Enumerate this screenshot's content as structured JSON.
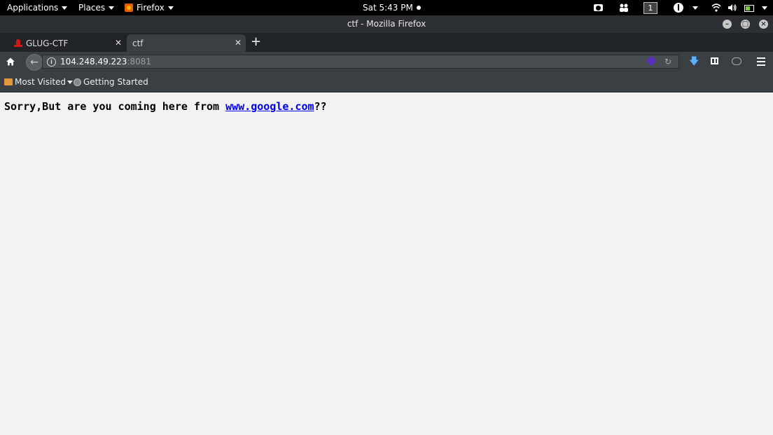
{
  "topbar": {
    "applications": "Applications",
    "places": "Places",
    "firefox": "Firefox",
    "clock": "Sat 5:43 PM",
    "workspace": "1"
  },
  "window": {
    "title": "ctf - Mozilla Firefox"
  },
  "tabs": [
    {
      "label": "GLUG-CTF"
    },
    {
      "label": "ctf"
    }
  ],
  "navbar": {
    "url_host": "104.248.49.223",
    "url_port": ":8081"
  },
  "bookmarks": {
    "most_visited": "Most Visited",
    "getting_started": "Getting Started"
  },
  "page": {
    "message_prefix": "Sorry,But are you coming here from ",
    "link_text": "www.google.com",
    "message_suffix": "??"
  },
  "colors": {
    "link": "#0000ee",
    "page_background": "#f2f2f2",
    "chrome_dark": "#3a3f44"
  }
}
